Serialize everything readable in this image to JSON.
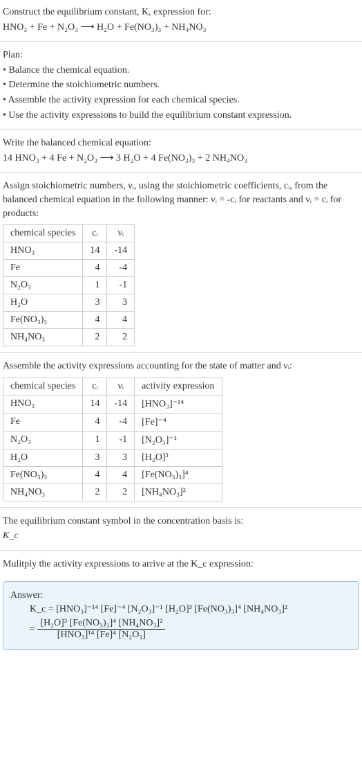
{
  "intro": {
    "line1": "Construct the equilibrium constant, K, expression for:",
    "eq": "HNO₃ + Fe + N₂O₃ ⟶ H₂O + Fe(NO₃)₃ + NH₄NO₃"
  },
  "plan": {
    "heading": "Plan:",
    "b1": "• Balance the chemical equation.",
    "b2": "• Determine the stoichiometric numbers.",
    "b3": "• Assemble the activity expression for each chemical species.",
    "b4": "• Use the activity expressions to build the equilibrium constant expression."
  },
  "balanced": {
    "heading": "Write the balanced chemical equation:",
    "eq": "14 HNO₃ + 4 Fe + N₂O₃ ⟶ 3 H₂O + 4 Fe(NO₃)₃ + 2 NH₄NO₃"
  },
  "assign": {
    "text": "Assign stoichiometric numbers, νᵢ, using the stoichiometric coefficients, cᵢ, from the balanced chemical equation in the following manner: νᵢ = -cᵢ for reactants and νᵢ = cᵢ for products:",
    "header": {
      "species": "chemical species",
      "ci": "cᵢ",
      "vi": "νᵢ"
    },
    "rows": [
      {
        "species": "HNO₃",
        "ci": "14",
        "vi": "-14"
      },
      {
        "species": "Fe",
        "ci": "4",
        "vi": "-4"
      },
      {
        "species": "N₂O₃",
        "ci": "1",
        "vi": "-1"
      },
      {
        "species": "H₂O",
        "ci": "3",
        "vi": "3"
      },
      {
        "species": "Fe(NO₃)₃",
        "ci": "4",
        "vi": "4"
      },
      {
        "species": "NH₄NO₃",
        "ci": "2",
        "vi": "2"
      }
    ]
  },
  "activity": {
    "text": "Assemble the activity expressions accounting for the state of matter and νᵢ:",
    "header": {
      "species": "chemical species",
      "ci": "cᵢ",
      "vi": "νᵢ",
      "ae": "activity expression"
    },
    "rows": [
      {
        "species": "HNO₃",
        "ci": "14",
        "vi": "-14",
        "ae": "[HNO₃]⁻¹⁴"
      },
      {
        "species": "Fe",
        "ci": "4",
        "vi": "-4",
        "ae": "[Fe]⁻⁴"
      },
      {
        "species": "N₂O₃",
        "ci": "1",
        "vi": "-1",
        "ae": "[N₂O₃]⁻¹"
      },
      {
        "species": "H₂O",
        "ci": "3",
        "vi": "3",
        "ae": "[H₂O]³"
      },
      {
        "species": "Fe(NO₃)₃",
        "ci": "4",
        "vi": "4",
        "ae": "[Fe(NO₃)₃]⁴"
      },
      {
        "species": "NH₄NO₃",
        "ci": "2",
        "vi": "2",
        "ae": "[NH₄NO₃]²"
      }
    ]
  },
  "kc_symbol": {
    "line1": "The equilibrium constant symbol in the concentration basis is:",
    "line2": "K_c"
  },
  "multiply": {
    "text": "Mulitply the activity expressions to arrive at the K_c expression:"
  },
  "answer": {
    "label": "Answer:",
    "line1": "K_c = [HNO₃]⁻¹⁴ [Fe]⁻⁴ [N₂O₃]⁻¹ [H₂O]³ [Fe(NO₃)₃]⁴ [NH₄NO₃]²",
    "frac_num": "[H₂O]³ [Fe(NO₃)₃]⁴ [NH₄NO₃]²",
    "frac_den": "[HNO₃]¹⁴ [Fe]⁴ [N₂O₃]",
    "eq_prefix": "= "
  },
  "chart_data": {
    "type": "table",
    "tables": [
      {
        "columns": [
          "chemical species",
          "cᵢ",
          "νᵢ"
        ],
        "rows": [
          [
            "HNO₃",
            14,
            -14
          ],
          [
            "Fe",
            4,
            -4
          ],
          [
            "N₂O₃",
            1,
            -1
          ],
          [
            "H₂O",
            3,
            3
          ],
          [
            "Fe(NO₃)₃",
            4,
            4
          ],
          [
            "NH₄NO₃",
            2,
            2
          ]
        ]
      },
      {
        "columns": [
          "chemical species",
          "cᵢ",
          "νᵢ",
          "activity expression"
        ],
        "rows": [
          [
            "HNO₃",
            14,
            -14,
            "[HNO₃]^-14"
          ],
          [
            "Fe",
            4,
            -4,
            "[Fe]^-4"
          ],
          [
            "N₂O₃",
            1,
            -1,
            "[N₂O₃]^-1"
          ],
          [
            "H₂O",
            3,
            3,
            "[H₂O]^3"
          ],
          [
            "Fe(NO₃)₃",
            4,
            4,
            "[Fe(NO₃)₃]^4"
          ],
          [
            "NH₄NO₃",
            2,
            2,
            "[NH₄NO₃]^2"
          ]
        ]
      }
    ]
  }
}
